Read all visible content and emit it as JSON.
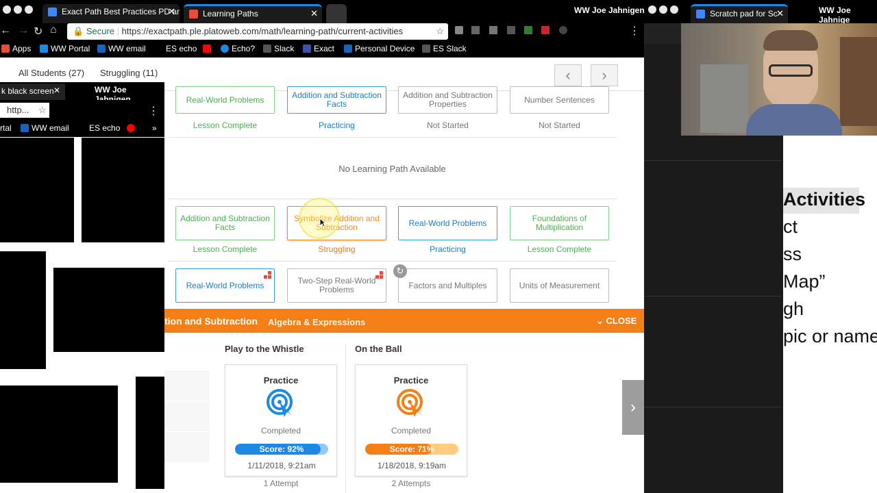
{
  "tabs": [
    {
      "title": "Exact Path Best Practices PD and",
      "icon_color": "#4285f4"
    },
    {
      "title": "Learning Paths",
      "icon_color": "#e74c3c"
    }
  ],
  "right_tab": {
    "title": "Scratch pad for Sc"
  },
  "user_name": "WW Joe Jahnigen",
  "user_name_right": "WW Joe Jahnige",
  "address": {
    "secure_label": "Secure",
    "url": "https://exactpath.ple.platoweb.com/math/learning-path/current-activities"
  },
  "bookmarks": [
    {
      "label": "Apps",
      "color": "#e74c3c"
    },
    {
      "label": "WW Portal",
      "color": "#1e88e5"
    },
    {
      "label": "WW email",
      "color": "#1565c0"
    },
    {
      "label": "ES echo",
      "color": "#ff0000"
    },
    {
      "label": "Echo?",
      "color": "#1e88e5"
    },
    {
      "label": "Slack",
      "color": "#555"
    },
    {
      "label": "Exact",
      "color": "#3f51b5"
    },
    {
      "label": "Personal Device",
      "color": "#1565c0"
    },
    {
      "label": "ES Slack",
      "color": "#555"
    }
  ],
  "filters": {
    "all": "All Students (27)",
    "struggling": "Struggling (11)"
  },
  "nav": {
    "prev": "‹",
    "next": "›"
  },
  "row1": [
    {
      "label": "Real-World Problems",
      "status": "Lesson Complete",
      "style": "green"
    },
    {
      "label": "Addition and Subtraction Facts",
      "status": "Practicing",
      "style": "blue"
    },
    {
      "label": "Addition and Subtraction Properties",
      "status": "Not Started",
      "style": "gray"
    },
    {
      "label": "Number Sentences",
      "status": "Not Started",
      "style": "gray"
    }
  ],
  "no_path": "No Learning Path Available",
  "row2": [
    {
      "label": "Addition and Subtraction Facts",
      "status": "Lesson Complete",
      "style": "green"
    },
    {
      "label": "Symbolize Addition and Subtraction",
      "status": "Struggling",
      "style": "orange"
    },
    {
      "label": "Real-World Problems",
      "status": "Practicing",
      "style": "blue"
    },
    {
      "label": "Foundations of Multiplication",
      "status": "Lesson Complete",
      "style": "green"
    }
  ],
  "row3": [
    {
      "label": "Real-World Problems",
      "style": "blue"
    },
    {
      "label": "Two-Step Real-World Problems",
      "style": "gray"
    },
    {
      "label": "Factors and Multiples",
      "style": "gray"
    },
    {
      "label": "Units of Measurement",
      "style": "gray"
    }
  ],
  "panel": {
    "title": "tion and Subtraction",
    "subtitle": "Algebra & Expressions",
    "close": "CLOSE",
    "activities": [
      {
        "name": "Play to the Whistle",
        "type": "Practice",
        "state": "Completed",
        "score": "Score: 92%",
        "score_value": 92,
        "date": "1/11/2018, 9:21am",
        "attempts": "1 Attempt",
        "color": "#1e88e5",
        "track": "#90caf9"
      },
      {
        "name": "On the Ball",
        "type": "Practice",
        "state": "Completed",
        "score": "Score: 71%",
        "score_value": 71,
        "date": "1/18/2018, 9:19am",
        "attempts": "2 Attempts",
        "color": "#f57f17",
        "track": "#ffcc80"
      }
    ]
  },
  "left_window": {
    "tab": "k black screen",
    "user": "WW Joe Jahnigen",
    "url": "http...",
    "bm1": "rtal",
    "bm2": "WW email",
    "bm3": "ES echo",
    "more": "»"
  },
  "slide_lines": [
    "Activities",
    "ct",
    "ss",
    "Map”",
    "gh",
    "pic or name"
  ]
}
